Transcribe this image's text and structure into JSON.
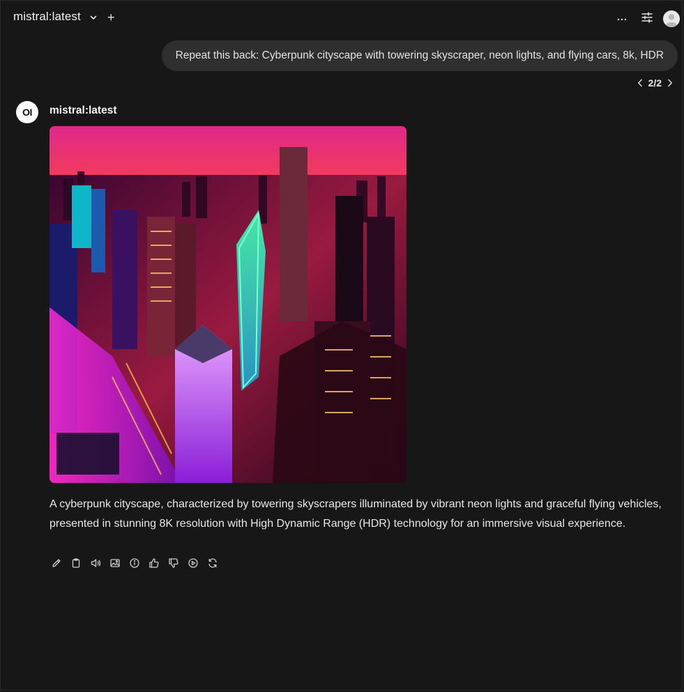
{
  "header": {
    "model_name": "mistral:latest",
    "add_label": "+",
    "more_label": "···"
  },
  "user_message": {
    "text": "Repeat this back: Cyberpunk cityscape with towering skyscraper, neon lights, and flying cars, 8k, HDR"
  },
  "pager": {
    "text": "2/2"
  },
  "assistant": {
    "logo_text": "OI",
    "name": "mistral:latest",
    "image": {
      "subject": "cyberpunk-cityscape"
    },
    "response": "A cyberpunk cityscape, characterized by towering skyscrapers illuminated by vibrant neon lights and graceful flying vehicles, presented in stunning 8K resolution with High Dynamic Range (HDR) technology for an immersive visual experience.",
    "actions": [
      "edit-icon",
      "copy-icon",
      "speaker-icon",
      "image-icon",
      "info-icon",
      "thumbs-up-icon",
      "thumbs-down-icon",
      "play-icon",
      "regenerate-icon"
    ]
  },
  "colors": {
    "background": "#171717",
    "bubble": "#2f2f2f",
    "text": "#ececec"
  }
}
